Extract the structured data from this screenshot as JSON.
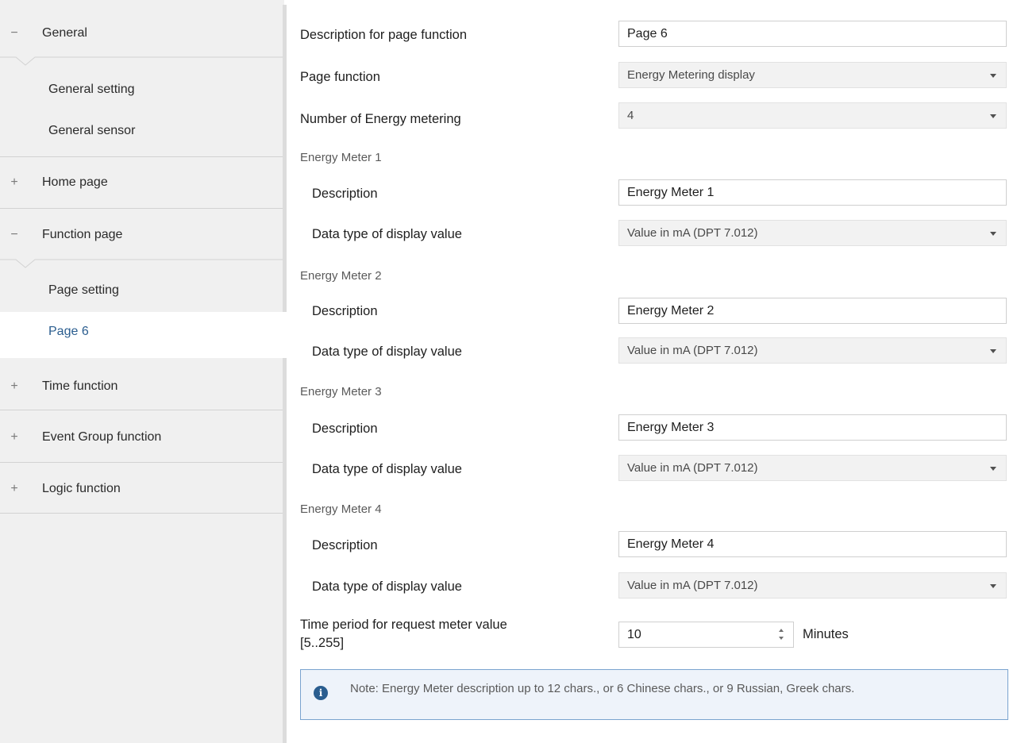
{
  "sidebar": {
    "general": {
      "glyph": "−",
      "label": "General"
    },
    "general_setting": "General setting",
    "general_sensor": "General sensor",
    "home_page": {
      "glyph": "+",
      "label": "Home page"
    },
    "function_page": {
      "glyph": "−",
      "label": "Function page"
    },
    "page_setting": "Page setting",
    "page6": "Page 6",
    "time_function": {
      "glyph": "+",
      "label": "Time function"
    },
    "event_group_function": {
      "glyph": "+",
      "label": "Event Group function"
    },
    "logic_function": {
      "glyph": "+",
      "label": "Logic function"
    }
  },
  "main": {
    "page_desc": {
      "label": "Description for page function",
      "value": "Page 6"
    },
    "page_function": {
      "label": "Page function",
      "value": "Energy Metering display"
    },
    "number_meters": {
      "label": "Number of  Energy metering",
      "value": "4"
    },
    "meters": [
      {
        "title": "Energy Meter 1",
        "desc_label": "Description",
        "desc_value": "Energy Meter 1",
        "type_label": "Data type of display value",
        "type_value": "Value in mA (DPT 7.012)"
      },
      {
        "title": "Energy Meter 2",
        "desc_label": "Description",
        "desc_value": "Energy Meter 2",
        "type_label": "Data type of display value",
        "type_value": "Value in mA (DPT 7.012)"
      },
      {
        "title": "Energy Meter 3",
        "desc_label": "Description",
        "desc_value": "Energy Meter 3",
        "type_label": "Data type of display value",
        "type_value": "Value in mA (DPT 7.012)"
      },
      {
        "title": "Energy Meter 4",
        "desc_label": "Description",
        "desc_value": "Energy Meter 4",
        "type_label": "Data type of display value",
        "type_value": "Value in mA (DPT 7.012)"
      }
    ],
    "time_period": {
      "label_line1": "Time period for request meter value",
      "label_line2": "[5..255]",
      "value": "10",
      "unit": "Minutes"
    },
    "note": {
      "icon": "i",
      "text": "Note: Energy Meter description up to 12 chars., or 6 Chinese chars., or 9 Russian, Greek chars."
    }
  },
  "colors": {
    "accent": "#2a5d8f",
    "sidebar_bg": "#f0f0f0",
    "note_border": "#7aa3cf"
  }
}
